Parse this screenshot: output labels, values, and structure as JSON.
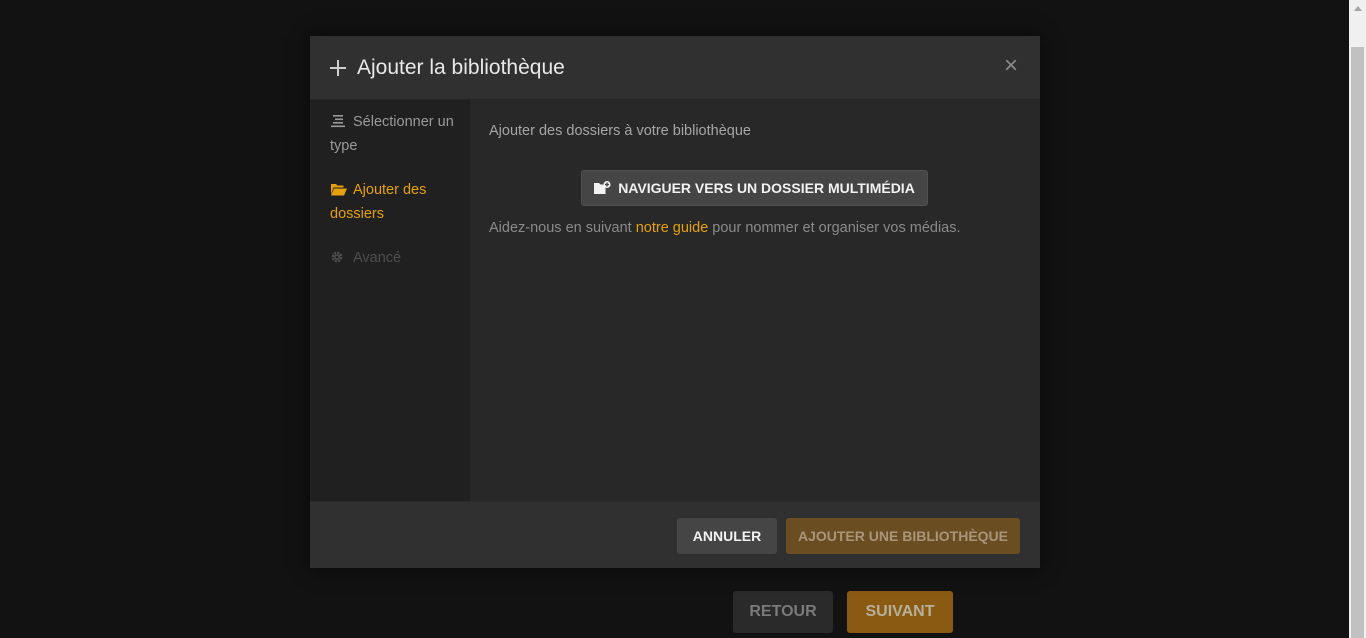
{
  "modal": {
    "title": "Ajouter la bibliothèque",
    "close_symbol": "×"
  },
  "sidebar": {
    "steps": [
      {
        "label": "Sélectionner un type",
        "icon": "list-icon",
        "state": "done"
      },
      {
        "label": "Ajouter des dossiers",
        "icon": "folder-open-icon",
        "state": "active"
      },
      {
        "label": "Avancé",
        "icon": "gear-icon",
        "state": "disabled"
      }
    ]
  },
  "content": {
    "heading": "Ajouter des dossiers à votre bibliothèque",
    "browse_label": "NAVIGUER VERS UN DOSSIER MULTIMÉDIA",
    "help_before": "Aidez-nous en suivant ",
    "help_link": "notre guide",
    "help_after": " pour nommer et organiser vos médias."
  },
  "footer": {
    "cancel_label": "ANNULER",
    "add_label": "AJOUTER UNE BIBLIOTHÈQUE"
  },
  "background": {
    "back_label": "RETOUR",
    "next_label": "SUIVANT"
  },
  "colors": {
    "accent": "#e5a00d",
    "modal_bg": "#282828",
    "sidebar_bg": "#202020",
    "page_bg": "#121212"
  }
}
